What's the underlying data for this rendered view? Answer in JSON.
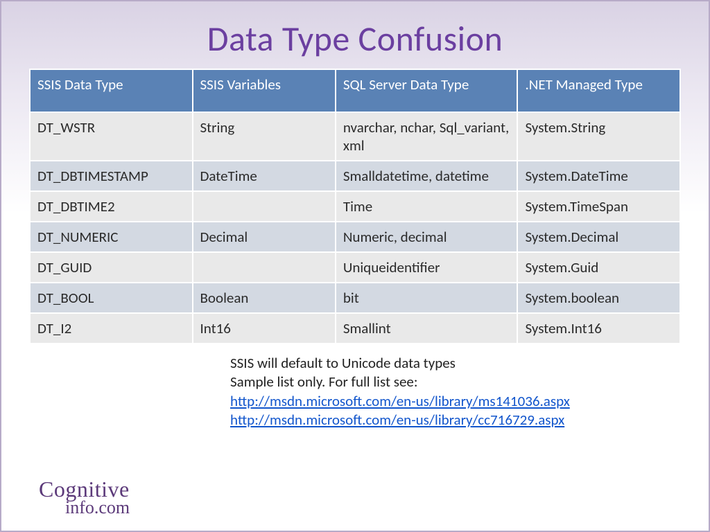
{
  "title": "Data Type Confusion",
  "table": {
    "headers": [
      "SSIS Data Type",
      "SSIS Variables",
      "SQL Server Data Type",
      ".NET Managed Type"
    ],
    "rows": [
      [
        "DT_WSTR",
        "String",
        "nvarchar, nchar, Sql_variant, xml",
        "System.String"
      ],
      [
        "DT_DBTIMESTAMP",
        "DateTime",
        "Smalldatetime, datetime",
        "System.DateTime"
      ],
      [
        "DT_DBTIME2",
        "",
        "Time",
        "System.TimeSpan"
      ],
      [
        "DT_NUMERIC",
        "Decimal",
        "Numeric, decimal",
        "System.Decimal"
      ],
      [
        "DT_GUID",
        "",
        "Uniqueidentifier",
        "System.Guid"
      ],
      [
        "DT_BOOL",
        "Boolean",
        "bit",
        "System.boolean"
      ],
      [
        "DT_I2",
        "Int16",
        "Smallint",
        "System.Int16"
      ]
    ]
  },
  "notes": {
    "line1": "SSIS will default to Unicode data types",
    "line2": "Sample list only.  For full list see:",
    "link1": "http://msdn.microsoft.com/en-us/library/ms141036.aspx",
    "link2": "http://msdn.microsoft.com/en-us/library/cc716729.aspx"
  },
  "logo": {
    "line1": "Cognitive",
    "line2": "info.com"
  }
}
